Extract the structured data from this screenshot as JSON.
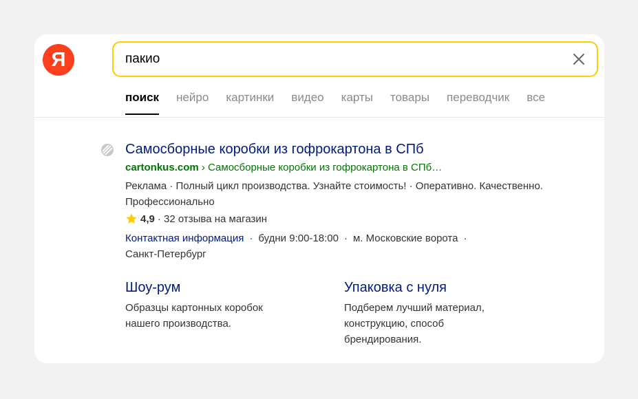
{
  "logo": {
    "letter": "Я",
    "color": "#fc3f1d"
  },
  "search": {
    "query": "пакио",
    "accent": "#ffcc00"
  },
  "tabs": [
    {
      "label": "поиск",
      "active": true
    },
    {
      "label": "нейро"
    },
    {
      "label": "картинки"
    },
    {
      "label": "видео"
    },
    {
      "label": "карты"
    },
    {
      "label": "товары"
    },
    {
      "label": "переводчик"
    },
    {
      "label": "все"
    }
  ],
  "result": {
    "title": "Самосборные коробки из гофрокартона в СПб",
    "domain": "cartonkus.com",
    "breadcrumb": " › Самосборные коробки из гофрокартона в СПб…",
    "description": "Реклама · Полный цикл производства. Узнайте стоимость! · Оперативно. Качественно. Профессионально",
    "rating": {
      "score": "4,9",
      "reviews": "· 32 отзыва на магазин",
      "star_color": "#ffcc00"
    },
    "contacts": {
      "link": "Контактная информация",
      "sep": "·",
      "hours": "будни 9:00-18:00",
      "metro": "м. Московские ворота",
      "city": "Санкт-Петербург"
    },
    "sitelinks": [
      {
        "title": "Шоу-рум",
        "desc": "Образцы картонных коробок нашего производства."
      },
      {
        "title": "Упаковка с нуля",
        "desc": "Подберем лучший материал, конструкцию, способ брендирования."
      }
    ]
  },
  "colors": {
    "link": "#001a80",
    "url": "#007700"
  }
}
